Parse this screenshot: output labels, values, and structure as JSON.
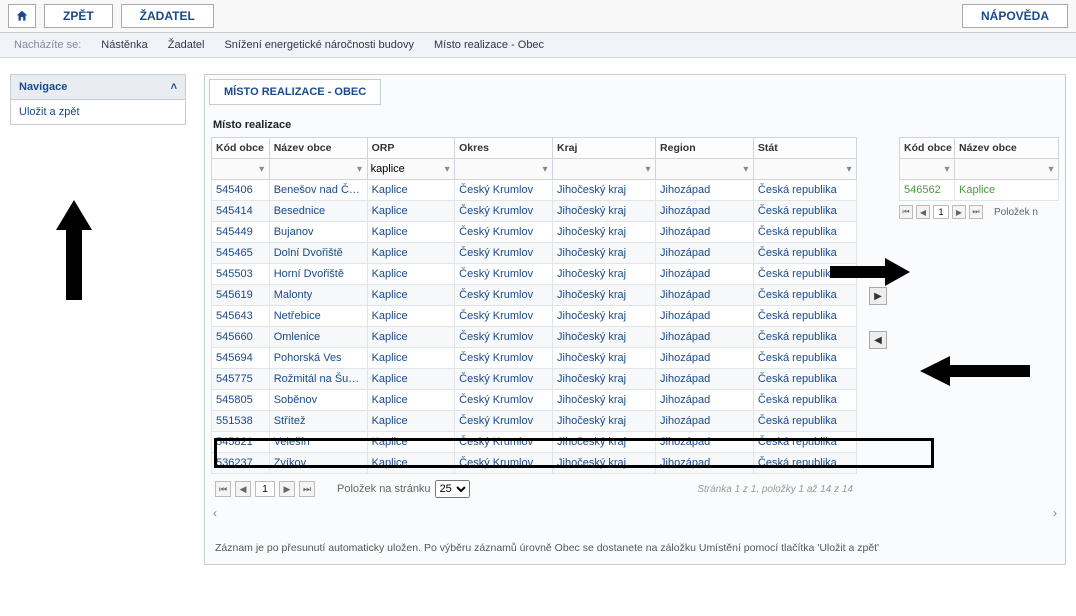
{
  "toolbar": {
    "back": "ZPĚT",
    "applicant": "ŽADATEL",
    "help": "NÁPOVĚDA"
  },
  "breadcrumb": {
    "label": "Nacházíte se:",
    "items": [
      "Nástěnka",
      "Žadatel",
      "Snížení energetické náročnosti budovy",
      "Místo realizace - Obec"
    ]
  },
  "sidebar": {
    "nav_title": "Navigace",
    "save_back": "Uložit a zpět"
  },
  "tab_title": "MÍSTO REALIZACE - OBEC",
  "section_title": "Místo realizace",
  "columns": {
    "kod": "Kód obce",
    "nazev": "Název obce",
    "orp": "ORP",
    "okres": "Okres",
    "kraj": "Kraj",
    "region": "Region",
    "stat": "Stát"
  },
  "filters": {
    "orp": "kaplice"
  },
  "rows": [
    {
      "kod": "545406",
      "nazev": "Benešov nad Čer…",
      "orp": "Kaplice",
      "okres": "Český Krumlov",
      "kraj": "Jihočeský kraj",
      "region": "Jihozápad",
      "stat": "Česká republika"
    },
    {
      "kod": "545414",
      "nazev": "Besednice",
      "orp": "Kaplice",
      "okres": "Český Krumlov",
      "kraj": "Jihočeský kraj",
      "region": "Jihozápad",
      "stat": "Česká republika"
    },
    {
      "kod": "545449",
      "nazev": "Bujanov",
      "orp": "Kaplice",
      "okres": "Český Krumlov",
      "kraj": "Jihočeský kraj",
      "region": "Jihozápad",
      "stat": "Česká republika"
    },
    {
      "kod": "545465",
      "nazev": "Dolní Dvořiště",
      "orp": "Kaplice",
      "okres": "Český Krumlov",
      "kraj": "Jihočeský kraj",
      "region": "Jihozápad",
      "stat": "Česká republika"
    },
    {
      "kod": "545503",
      "nazev": "Horní Dvořiště",
      "orp": "Kaplice",
      "okres": "Český Krumlov",
      "kraj": "Jihočeský kraj",
      "region": "Jihozápad",
      "stat": "Česká republika"
    },
    {
      "kod": "545619",
      "nazev": "Malonty",
      "orp": "Kaplice",
      "okres": "Český Krumlov",
      "kraj": "Jihočeský kraj",
      "region": "Jihozápad",
      "stat": "Česká republika"
    },
    {
      "kod": "545643",
      "nazev": "Netřebice",
      "orp": "Kaplice",
      "okres": "Český Krumlov",
      "kraj": "Jihočeský kraj",
      "region": "Jihozápad",
      "stat": "Česká republika"
    },
    {
      "kod": "545660",
      "nazev": "Omlenice",
      "orp": "Kaplice",
      "okres": "Český Krumlov",
      "kraj": "Jihočeský kraj",
      "region": "Jihozápad",
      "stat": "Česká republika"
    },
    {
      "kod": "545694",
      "nazev": "Pohorská Ves",
      "orp": "Kaplice",
      "okres": "Český Krumlov",
      "kraj": "Jihočeský kraj",
      "region": "Jihozápad",
      "stat": "Česká republika"
    },
    {
      "kod": "545775",
      "nazev": "Rožmitál na Šum…",
      "orp": "Kaplice",
      "okres": "Český Krumlov",
      "kraj": "Jihočeský kraj",
      "region": "Jihozápad",
      "stat": "Česká republika"
    },
    {
      "kod": "545805",
      "nazev": "Soběnov",
      "orp": "Kaplice",
      "okres": "Český Krumlov",
      "kraj": "Jihočeský kraj",
      "region": "Jihozápad",
      "stat": "Česká republika"
    },
    {
      "kod": "551538",
      "nazev": "Střítež",
      "orp": "Kaplice",
      "okres": "Český Krumlov",
      "kraj": "Jihočeský kraj",
      "region": "Jihozápad",
      "stat": "Česká republika"
    },
    {
      "kod": "545821",
      "nazev": "Velešín",
      "orp": "Kaplice",
      "okres": "Český Krumlov",
      "kraj": "Jihočeský kraj",
      "region": "Jihozápad",
      "stat": "Česká republika"
    },
    {
      "kod": "536237",
      "nazev": "Zvíkov",
      "orp": "Kaplice",
      "okres": "Český Krumlov",
      "kraj": "Jihočeský kraj",
      "region": "Jihozápad",
      "stat": "Česká republika"
    }
  ],
  "pager": {
    "page": "1",
    "per_page_label": "Položek na stránku",
    "per_page_value": "25",
    "summary": "Stránka 1 z 1, položky 1 až 14 z 14"
  },
  "right_columns": {
    "kod": "Kód obce",
    "nazev": "Název obce"
  },
  "right_rows": [
    {
      "kod": "546562",
      "nazev": "Kaplice"
    }
  ],
  "right_pager": {
    "page": "1",
    "tail": "Položek n"
  },
  "footnote": "Záznam je po přesunutí automaticky uložen. Po výběru záznamů úrovně Obec se dostanete na záložku Umístění pomocí tlačítka 'Uložit a zpět'"
}
